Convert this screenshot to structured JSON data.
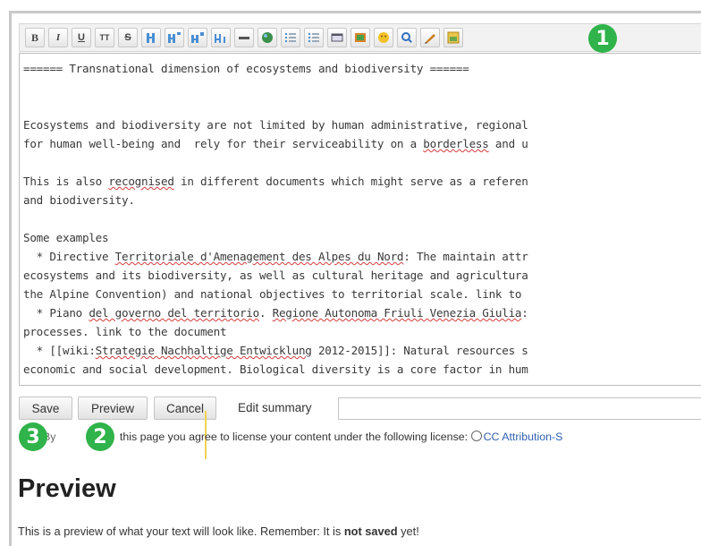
{
  "toolbar": {
    "buttons": [
      {
        "name": "bold-button",
        "glyph": "B"
      },
      {
        "name": "italic-button",
        "glyph": "I"
      },
      {
        "name": "underline-button",
        "glyph": "U"
      },
      {
        "name": "monospace-button",
        "glyph": "TT"
      },
      {
        "name": "strikethrough-button",
        "glyph": "S"
      }
    ],
    "icons": [
      "heading-1-icon",
      "heading-2-icon",
      "heading-3-icon",
      "heading-4-icon",
      "horizontal-rule-icon",
      "link-icon",
      "numbered-list-icon",
      "bulleted-list-icon",
      "table-icon",
      "image-icon",
      "smiley-icon",
      "search-icon",
      "signature-icon",
      "media-icon"
    ]
  },
  "badges": {
    "one": "1",
    "two": "2",
    "three": "3"
  },
  "editor": {
    "heading": "====== Transnational dimension of ecosystems and biodiversity ======",
    "p1_l1": "Ecosystems and biodiversity are not limited by human administrative, regional",
    "p1_l2a": "for human well-being and  rely for their serviceability on a ",
    "p1_l2b": "borderless",
    "p1_l2c": " and u",
    "p2_l1a": "This is also ",
    "p2_l1b": "recognised",
    "p2_l1c": " in different documents which might serve as a referen",
    "p2_l2": "and biodiversity.",
    "ex_title": "Some examples",
    "ex1_l1a": "  * Directive ",
    "ex1_l1b": "Territoriale d'Amenagement des Alpes du Nord",
    "ex1_l1c": ": The maintain attr",
    "ex1_l2": "ecosystems and its biodiversity, as well as cultural heritage and agricultura",
    "ex1_l3": "the Alpine Convention) and national objectives to territorial scale. link to",
    "ex2_l1a": "  * Piano ",
    "ex2_l1b": "del governo del territorio",
    "ex2_l1c": ". ",
    "ex2_l1d": "Regione Autonoma Friuli Venezia Giulia",
    "ex2_l1e": ":",
    "ex2_l2": "processes. link to the document",
    "ex3_l1a": "  * [[wiki:",
    "ex3_l1b": "Strategie Nachhaltige Entwicklung",
    "ex3_l1c": " 2012-2015]]: Natural resources s",
    "ex3_l2": "economic and social development. Biological diversity is a core factor in hum"
  },
  "buttons": {
    "save": "Save",
    "preview": "Preview",
    "cancel": "Cancel"
  },
  "summary": {
    "label": "Edit summary",
    "value": ""
  },
  "license": {
    "prefix": "By",
    "text": "this page you agree to license your content under the following license:",
    "link": "CC Attribution-S"
  },
  "preview": {
    "heading": "Preview",
    "text_before": "This is a preview of what your text will look like. Remember: It is ",
    "text_bold": "not saved",
    "text_after": " yet!"
  }
}
